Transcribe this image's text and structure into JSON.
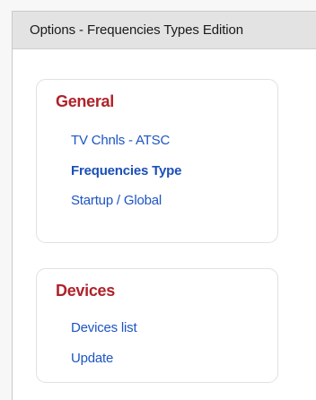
{
  "window": {
    "title": "Options - Frequencies Types Edition"
  },
  "general": {
    "heading": "General",
    "items": [
      {
        "label": "TV Chnls - ATSC",
        "active": false
      },
      {
        "label": "Frequencies Type",
        "active": true
      },
      {
        "label": "Startup / Global",
        "active": false
      }
    ]
  },
  "devices": {
    "heading": "Devices",
    "items": [
      {
        "label": "Devices list",
        "active": false
      },
      {
        "label": "Update",
        "active": false
      }
    ]
  },
  "colors": {
    "heading": "#b0222a",
    "link": "#1c55c4",
    "titlebar": "#e3e3e3"
  }
}
